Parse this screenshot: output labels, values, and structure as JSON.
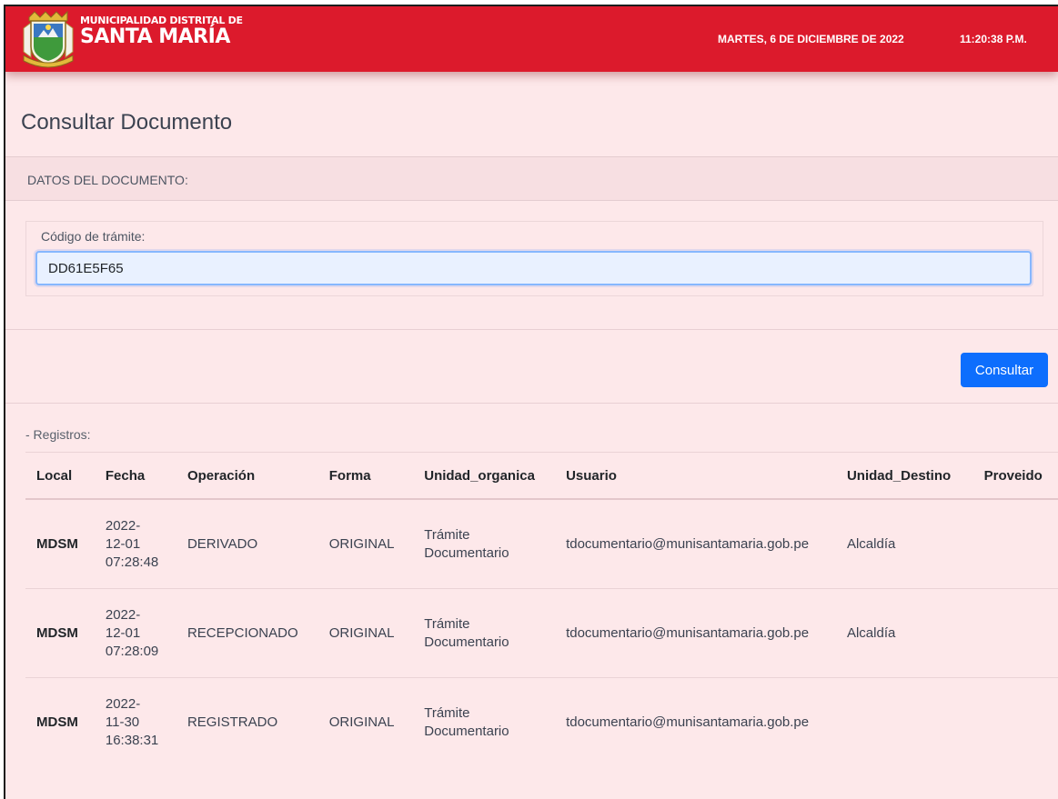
{
  "header": {
    "brand_line1": "MUNICIPALIDAD DISTRITAL DE",
    "brand_line2": "SANTA MARÍA",
    "date": "MARTES, 6 DE DICIEMBRE DE 2022",
    "time": "11:20:38 P.M.",
    "bar_color": "#dc1a2c"
  },
  "page": {
    "title": "Consultar Documento",
    "section_header": "DATOS DEL DOCUMENTO:"
  },
  "form": {
    "code_label": "Código de trámite:",
    "code_value": "DD61E5F65",
    "submit_label": "Consultar",
    "submit_color": "#0d6efd"
  },
  "records": {
    "label": "- Registros:",
    "columns": [
      "Local",
      "Fecha",
      "Operación",
      "Forma",
      "Unidad_organica",
      "Usuario",
      "Unidad_Destino",
      "Proveido"
    ],
    "rows": [
      {
        "local": "MDSM",
        "fecha": [
          "2022-",
          "12-01",
          "07:28:48"
        ],
        "operacion": "DERIVADO",
        "forma": "ORIGINAL",
        "unidad_organica": [
          "Trámite",
          "Documentario"
        ],
        "usuario": "tdocumentario@munisantamaria.gob.pe",
        "unidad_destino": "Alcaldía",
        "proveido": ""
      },
      {
        "local": "MDSM",
        "fecha": [
          "2022-",
          "12-01",
          "07:28:09"
        ],
        "operacion": "RECEPCIONADO",
        "forma": "ORIGINAL",
        "unidad_organica": [
          "Trámite",
          "Documentario"
        ],
        "usuario": "tdocumentario@munisantamaria.gob.pe",
        "unidad_destino": "Alcaldía",
        "proveido": ""
      },
      {
        "local": "MDSM",
        "fecha": [
          "2022-",
          "11-30",
          "16:38:31"
        ],
        "operacion": "REGISTRADO",
        "forma": "ORIGINAL",
        "unidad_organica": [
          "Trámite",
          "Documentario"
        ],
        "usuario": "tdocumentario@munisantamaria.gob.pe",
        "unidad_destino": "",
        "proveido": ""
      }
    ]
  }
}
